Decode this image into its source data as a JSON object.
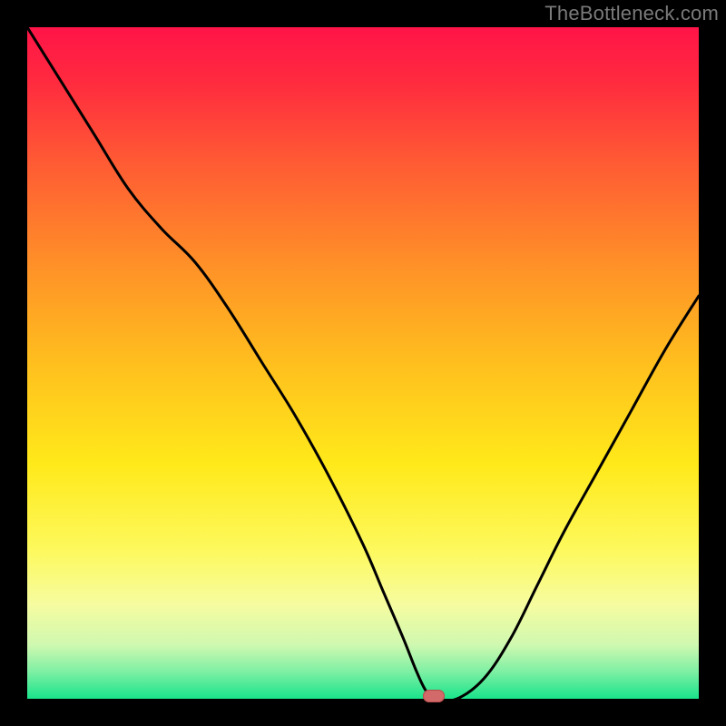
{
  "watermark": "TheBottleneck.com",
  "colors": {
    "frame": "#000000",
    "gradient_stops": [
      {
        "offset": 0.0,
        "color": "#ff1448"
      },
      {
        "offset": 0.08,
        "color": "#ff2a3f"
      },
      {
        "offset": 0.2,
        "color": "#ff5a34"
      },
      {
        "offset": 0.35,
        "color": "#ff8f28"
      },
      {
        "offset": 0.5,
        "color": "#ffbf1e"
      },
      {
        "offset": 0.65,
        "color": "#ffe91a"
      },
      {
        "offset": 0.78,
        "color": "#fdf95e"
      },
      {
        "offset": 0.86,
        "color": "#f6fca0"
      },
      {
        "offset": 0.92,
        "color": "#cff8b0"
      },
      {
        "offset": 0.96,
        "color": "#7df0a4"
      },
      {
        "offset": 1.0,
        "color": "#19e38a"
      }
    ],
    "curve": "#000000",
    "marker_fill": "#d36a6a",
    "marker_stroke": "#b94c4c"
  },
  "chart_data": {
    "type": "line",
    "title": "",
    "xlabel": "",
    "ylabel": "",
    "xlim": [
      0,
      100
    ],
    "ylim": [
      0,
      100
    ],
    "grid": false,
    "legend": false,
    "series": [
      {
        "name": "bottleneck-curve",
        "x": [
          0,
          5,
          10,
          15,
          20,
          25,
          30,
          35,
          40,
          45,
          50,
          53,
          56,
          58,
          59.5,
          61,
          64,
          68,
          72,
          76,
          80,
          85,
          90,
          95,
          100
        ],
        "y": [
          100,
          92,
          84,
          76,
          70,
          65,
          58,
          50,
          42,
          33,
          23,
          16,
          9,
          4,
          1,
          0,
          0,
          3,
          9,
          17,
          25,
          34,
          43,
          52,
          60
        ]
      }
    ],
    "marker": {
      "x": 60.5,
      "y": 0
    }
  }
}
